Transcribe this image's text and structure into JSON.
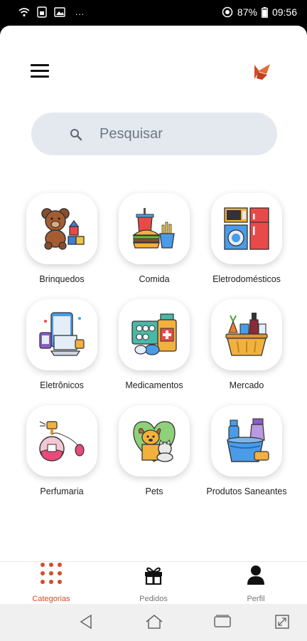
{
  "status_bar": {
    "battery": "87%",
    "time": "09:56",
    "overflow": "..."
  },
  "search": {
    "placeholder": "Pesquisar"
  },
  "categories": [
    {
      "label": "Brinquedos"
    },
    {
      "label": "Comida"
    },
    {
      "label": "Eletrodomésticos"
    },
    {
      "label": "Eletrônicos"
    },
    {
      "label": "Medicamentos"
    },
    {
      "label": "Mercado"
    },
    {
      "label": "Perfumaria"
    },
    {
      "label": "Pets"
    },
    {
      "label": "Produtos Saneantes"
    }
  ],
  "bottom_nav": {
    "items": [
      {
        "label": "Categorias",
        "icon": "grid-dots-icon",
        "active": true
      },
      {
        "label": "Pedidos",
        "icon": "gift-icon",
        "active": false
      },
      {
        "label": "Perfil",
        "icon": "user-icon",
        "active": false
      }
    ]
  },
  "colors": {
    "accent": "#d24e2a",
    "search_bg": "#e4e9f0"
  }
}
